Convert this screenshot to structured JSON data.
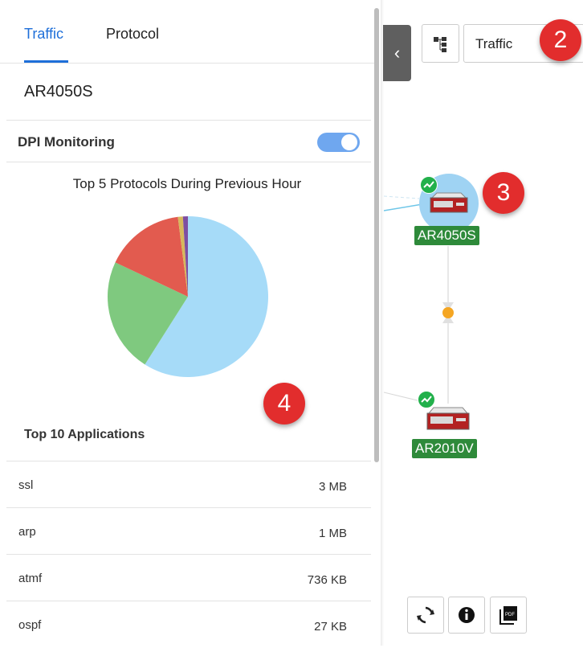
{
  "tabs": [
    {
      "label": "Traffic",
      "active": true
    },
    {
      "label": "Protocol",
      "active": false
    }
  ],
  "device": {
    "name": "AR4050S"
  },
  "dpi": {
    "label": "DPI Monitoring",
    "enabled": true
  },
  "chart_data": {
    "type": "pie",
    "title": "Top 5 Protocols During Previous Hour",
    "slices": [
      {
        "value": 59,
        "color": "#a6dbf8"
      },
      {
        "value": 23,
        "color": "#7fc97f"
      },
      {
        "value": 16,
        "color": "#e25b4f"
      },
      {
        "value": 1,
        "color": "#d6b85c"
      },
      {
        "value": 1,
        "color": "#7e4ea1"
      }
    ]
  },
  "apps": {
    "title": "Top 10 Applications",
    "rows": [
      {
        "name": "ssl",
        "value": "3 MB"
      },
      {
        "name": "arp",
        "value": "1 MB"
      },
      {
        "name": "atmf",
        "value": "736 KB"
      },
      {
        "name": "ospf",
        "value": "27 KB"
      }
    ]
  },
  "map": {
    "view_select": "Traffic",
    "nodes": [
      {
        "label": "AR4050S",
        "selected": true
      },
      {
        "label": "AR2010V",
        "selected": false
      }
    ],
    "badges": [
      "2",
      "3",
      "4"
    ]
  },
  "icons": {
    "collapse": "chevron-left-icon",
    "tree": "hierarchy-icon",
    "refresh": "refresh-icon",
    "info": "info-icon",
    "pdf": "pdf-icon"
  },
  "colors": {
    "accent": "#1e6fd9",
    "badge": "#e22d2d",
    "node_label": "#2e8a3a",
    "status": "#22b04b"
  }
}
